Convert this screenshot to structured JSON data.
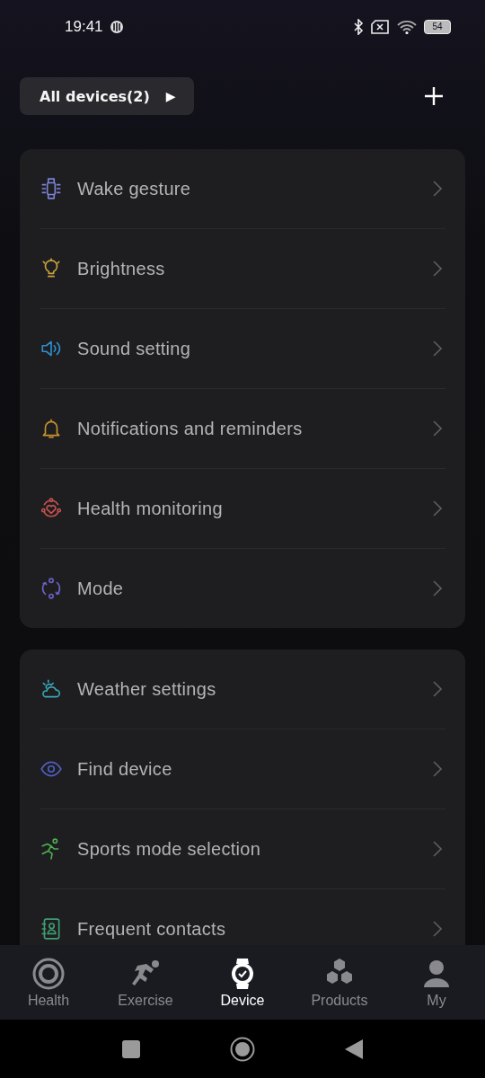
{
  "status_bar": {
    "time": "19:41",
    "battery": "54"
  },
  "header": {
    "device_selector": "All devices(2)",
    "selector_arrow": "▶"
  },
  "groups": [
    {
      "items": [
        {
          "kind": "watch",
          "label": "Wake gesture",
          "color": "#7b83d6"
        },
        {
          "kind": "bulb",
          "label": "Brightness",
          "color": "#c9a23a"
        },
        {
          "kind": "speaker",
          "label": "Sound setting",
          "color": "#2f8fd0"
        },
        {
          "kind": "bell",
          "label": "Notifications and reminders",
          "color": "#c9922e"
        },
        {
          "kind": "heart",
          "label": "Health monitoring",
          "color": "#c9524e"
        },
        {
          "kind": "mode",
          "label": "Mode",
          "color": "#6a62c8"
        }
      ]
    },
    {
      "items": [
        {
          "kind": "weather",
          "label": "Weather settings",
          "color": "#3aa6b8"
        },
        {
          "kind": "eye",
          "label": "Find device",
          "color": "#4f5fc0"
        },
        {
          "kind": "runner",
          "label": "Sports mode selection",
          "color": "#4caf50"
        },
        {
          "kind": "contact",
          "label": "Frequent contacts",
          "color": "#3e9e72"
        }
      ]
    }
  ],
  "tabs": [
    {
      "kind": "rings",
      "label": "Health",
      "selected": false
    },
    {
      "kind": "runner",
      "label": "Exercise",
      "selected": false
    },
    {
      "kind": "watch",
      "label": "Device",
      "selected": true
    },
    {
      "kind": "hex",
      "label": "Products",
      "selected": false
    },
    {
      "kind": "person",
      "label": "My",
      "selected": false
    }
  ]
}
